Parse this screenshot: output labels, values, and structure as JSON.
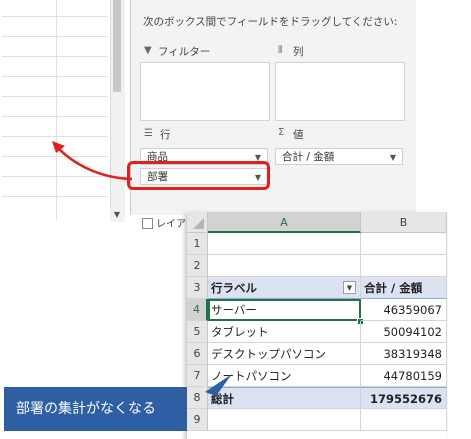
{
  "panel": {
    "hint": "次のボックス間でフィールドをドラッグしてください:",
    "filter_label": "フィルター",
    "columns_label": "列",
    "rows_label": "行",
    "values_label": "値",
    "rows_fields": [
      "商品",
      "部署"
    ],
    "values_fields": [
      "合計 / 金額"
    ],
    "defer_label": "レイア"
  },
  "sheet": {
    "columns": [
      "A",
      "B"
    ],
    "rows": [
      {
        "num": "1",
        "a": "",
        "b": ""
      },
      {
        "num": "2",
        "a": "",
        "b": ""
      },
      {
        "num": "3",
        "a": "行ラベル",
        "b": "合計 / 金額"
      },
      {
        "num": "4",
        "a": "サーバー",
        "b": "46359067"
      },
      {
        "num": "5",
        "a": "タブレット",
        "b": "50094102"
      },
      {
        "num": "6",
        "a": "デスクトップパソコン",
        "b": "38319348"
      },
      {
        "num": "7",
        "a": "ノートパソコン",
        "b": "44780159"
      },
      {
        "num": "8",
        "a": "総計",
        "b": "179552676"
      },
      {
        "num": "9",
        "a": "",
        "b": ""
      }
    ]
  },
  "callout": {
    "text": "部署の集計がなくなる"
  },
  "colors": {
    "highlight": "#e0201c",
    "callout_bg": "#2e5fa3",
    "header_fill": "#dbe3f3",
    "excel_green": "#217346"
  },
  "icons": {
    "filter": "funnel-icon",
    "columns": "columns-icon",
    "rows": "rows-icon",
    "values": "sigma-icon"
  }
}
